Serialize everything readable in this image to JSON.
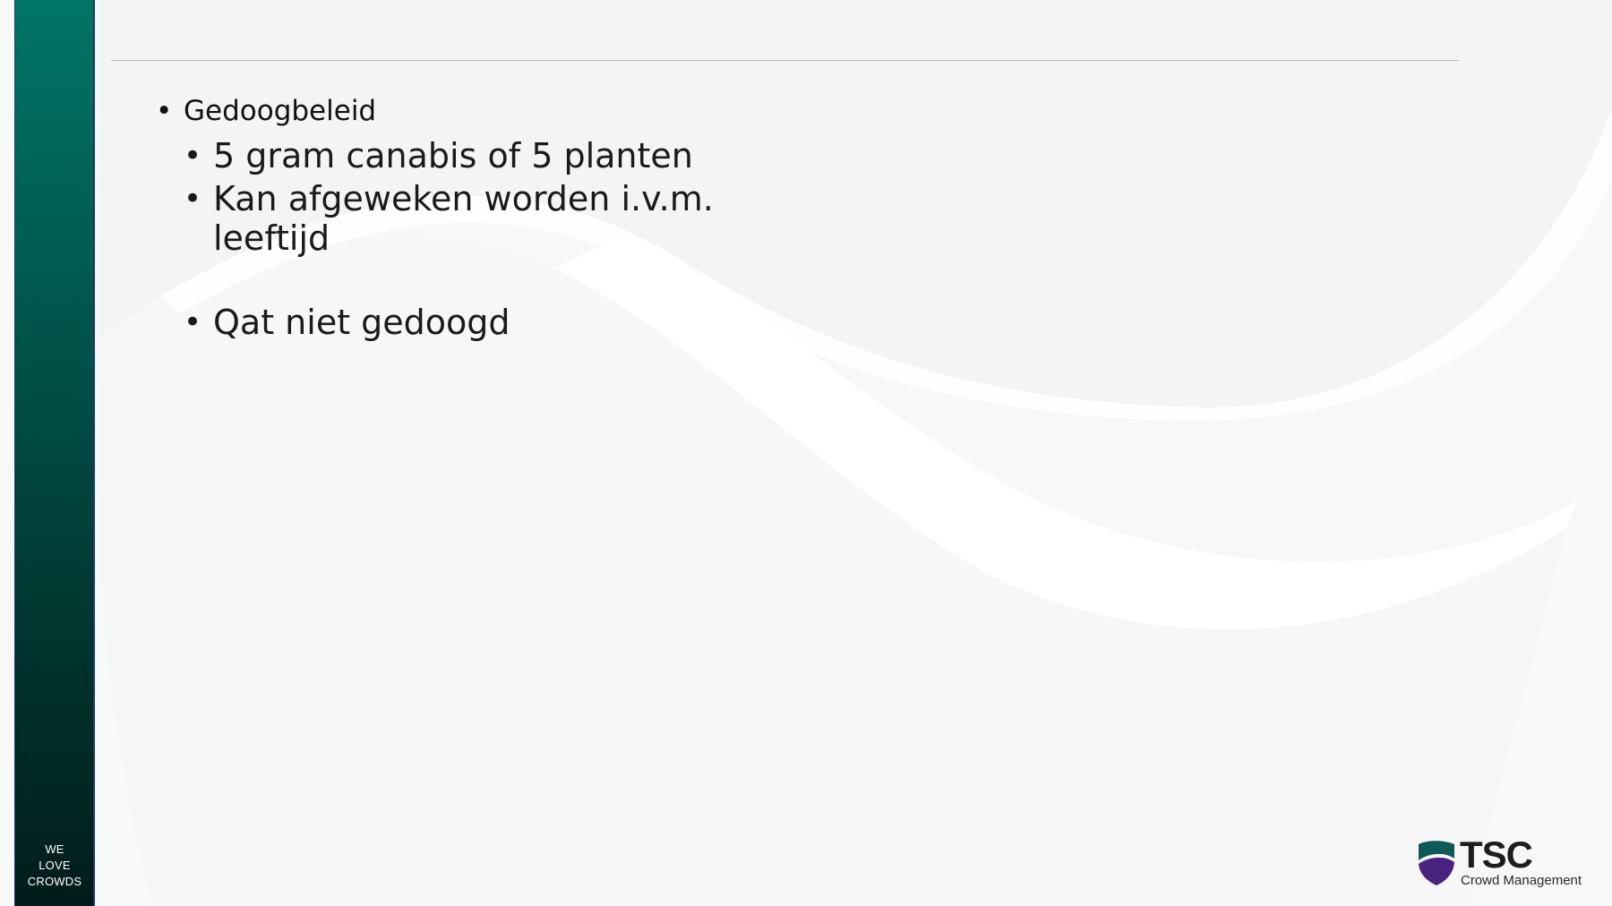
{
  "slide": {
    "sidebar_tagline": [
      "WE",
      "LOVE",
      "CROWDS"
    ],
    "bullets": {
      "heading": "Gedoogbeleid",
      "items": [
        "5 gram canabis of 5 planten",
        "Kan afgeweken worden i.v.m. leeftijd",
        "Qat niet gedoogd"
      ]
    },
    "logo": {
      "name": "TSC",
      "subtitle": "Crowd Management",
      "colors": {
        "teal": "#0f5a56",
        "purple": "#4a2380"
      }
    }
  },
  "colors": {
    "sidebar_top": "#007566",
    "sidebar_bottom": "#011c1a",
    "background": "#f7f8f8"
  }
}
